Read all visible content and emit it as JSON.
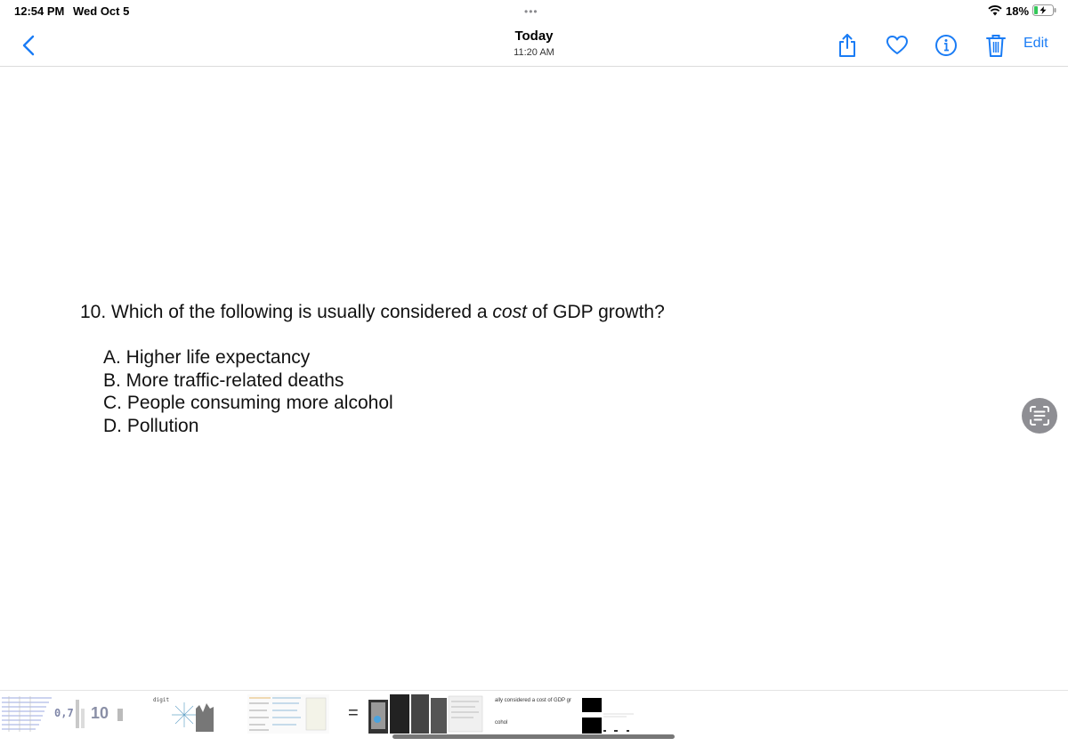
{
  "status_bar": {
    "time": "12:54 PM",
    "date": "Wed Oct 5",
    "battery": "18%",
    "icons": [
      "wifi-icon",
      "battery-charging-icon"
    ]
  },
  "nav": {
    "title": "Today",
    "subtitle": "11:20 AM",
    "edit_label": "Edit",
    "icons": [
      "chevron-left-icon",
      "share-icon",
      "heart-icon",
      "info-icon",
      "trash-icon"
    ],
    "accent_color": "#1a7cf5"
  },
  "content": {
    "question_prefix": "10. Which of the following is usually considered a ",
    "question_emph": "cost",
    "question_suffix": " of GDP growth?",
    "options": [
      "A. Higher life expectancy",
      "B. More traffic-related deaths",
      "C. People consuming more alcohol",
      "D. Pollution"
    ]
  },
  "thumbnails": {
    "t1_text": "0,7",
    "t2_text": "10",
    "t3_text": "digit",
    "t4_text": "=",
    "t5_line1": "ally considered a cost of GDP gr",
    "t5_line2": "cohol"
  }
}
